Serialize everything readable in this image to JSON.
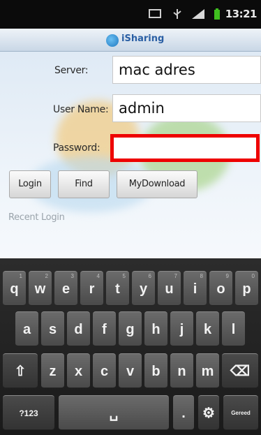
{
  "status_bar": {
    "time": "13:21"
  },
  "app": {
    "title": "iSharing"
  },
  "form": {
    "server_label": "Server:",
    "server_value": "mac adres",
    "username_label": "User Name:",
    "username_value": "admin",
    "password_label": "Password:",
    "password_value": ""
  },
  "buttons": {
    "login": "Login",
    "find": "Find",
    "mydownload": "MyDownload"
  },
  "recent_login_label": "Recent Login",
  "keyboard": {
    "row1": [
      "q",
      "w",
      "e",
      "r",
      "t",
      "y",
      "u",
      "i",
      "o",
      "p"
    ],
    "row1_hints": [
      "1",
      "2",
      "3",
      "4",
      "5",
      "6",
      "7",
      "8",
      "9",
      "0"
    ],
    "row2": [
      "a",
      "s",
      "d",
      "f",
      "g",
      "h",
      "j",
      "k",
      "l"
    ],
    "row3": [
      "z",
      "x",
      "c",
      "v",
      "b",
      "n",
      "m"
    ],
    "shift_symbol": "⇧",
    "backspace_symbol": "⌫",
    "symbols_key": "?123",
    "space_symbol": "␣",
    "period_key": ".",
    "settings_symbol": "⚙",
    "action_key": "Gereed"
  },
  "colors": {
    "accent": "#ee0000",
    "title_text": "#2a5fa4"
  }
}
